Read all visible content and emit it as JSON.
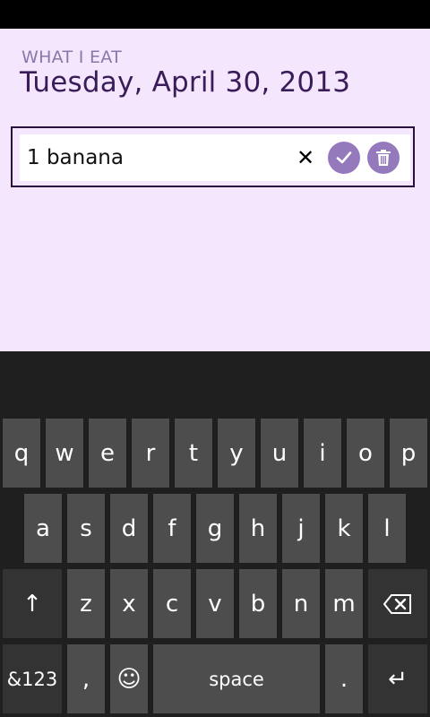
{
  "app": {
    "title": "WHAT I EAT",
    "date": "Tuesday, April 30, 2013"
  },
  "entry": {
    "value": "1 banana",
    "clear_icon": "close-icon",
    "confirm_icon": "checkmark-icon",
    "delete_icon": "trash-icon"
  },
  "colors": {
    "background": "#f3e6fd",
    "accent": "#9479bd",
    "keyboard": "#1f1f1f",
    "key": "#4d4d4d"
  },
  "keyboard": {
    "row1": [
      "q",
      "w",
      "e",
      "r",
      "t",
      "y",
      "u",
      "i",
      "o",
      "p"
    ],
    "row2": [
      "a",
      "s",
      "d",
      "f",
      "g",
      "h",
      "j",
      "k",
      "l"
    ],
    "row3": [
      "z",
      "x",
      "c",
      "v",
      "b",
      "n",
      "m"
    ],
    "shift": "↑",
    "backspace_icon": "backspace-icon",
    "symbols": "&123",
    "comma": ",",
    "emoji": "☺",
    "space": "space",
    "period": ".",
    "enter": "↵"
  }
}
